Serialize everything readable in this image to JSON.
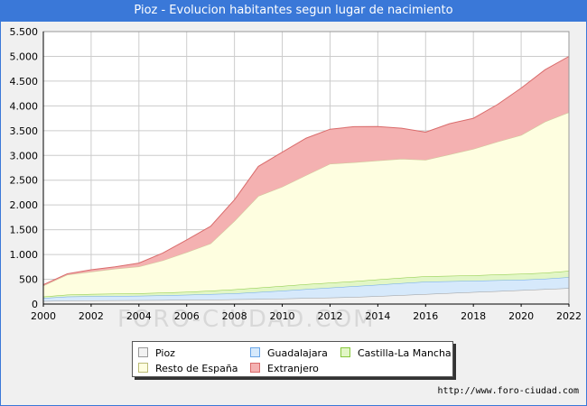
{
  "header": {
    "title": "Pioz - Evolucion habitantes segun lugar de nacimiento"
  },
  "footer": {
    "url": "http://www.foro-ciudad.com"
  },
  "watermark": "FORO-CIUDAD.COM",
  "chart_data": {
    "type": "area",
    "stacked": true,
    "x": [
      2000,
      2001,
      2002,
      2003,
      2004,
      2005,
      2006,
      2007,
      2008,
      2009,
      2010,
      2011,
      2012,
      2013,
      2014,
      2015,
      2016,
      2017,
      2018,
      2019,
      2020,
      2021,
      2022
    ],
    "xticks": [
      "2000",
      "2002",
      "2004",
      "2006",
      "2008",
      "2010",
      "2012",
      "2014",
      "2016",
      "2018",
      "2020",
      "2022"
    ],
    "xlim": [
      2000,
      2022
    ],
    "ylim": [
      0,
      5500
    ],
    "yticks": [
      0,
      500,
      1000,
      1500,
      2000,
      2500,
      3000,
      3500,
      4000,
      4500,
      5000,
      5500
    ],
    "ytick_labels": [
      "0",
      "500",
      "1.000",
      "1.500",
      "2.000",
      "2.500",
      "3.000",
      "3.500",
      "4.000",
      "4.500",
      "5.000",
      "5.500"
    ],
    "grid": true,
    "legend_position": "bottom",
    "series": [
      {
        "name": "Pioz",
        "color": "#f2f2f2",
        "line": "#999999",
        "values": [
          60,
          70,
          72,
          74,
          76,
          80,
          85,
          90,
          95,
          100,
          110,
          120,
          130,
          140,
          160,
          180,
          200,
          220,
          240,
          260,
          280,
          300,
          320
        ]
      },
      {
        "name": "Guadalajara",
        "color": "#d6e9fb",
        "line": "#6aa6e8",
        "values": [
          60,
          80,
          85,
          88,
          90,
          95,
          100,
          110,
          120,
          140,
          160,
          180,
          200,
          220,
          230,
          240,
          250,
          240,
          230,
          220,
          210,
          210,
          220
        ]
      },
      {
        "name": "Castilla-La Mancha",
        "color": "#e2f6c6",
        "line": "#86c83c",
        "values": [
          30,
          40,
          45,
          48,
          50,
          55,
          60,
          70,
          80,
          90,
          95,
          100,
          100,
          100,
          105,
          110,
          110,
          110,
          110,
          115,
          120,
          120,
          130
        ]
      },
      {
        "name": "Resto de España",
        "color": "#fefee0",
        "line": "#cccc99",
        "values": [
          220,
          400,
          450,
          500,
          540,
          650,
          800,
          950,
          1380,
          1850,
          2000,
          2200,
          2400,
          2400,
          2400,
          2400,
          2350,
          2450,
          2550,
          2680,
          2800,
          3050,
          3200
        ]
      },
      {
        "name": "Extranjero",
        "color": "#f4b1b1",
        "line": "#d96b6b",
        "values": [
          20,
          20,
          40,
          40,
          70,
          150,
          250,
          350,
          430,
          600,
          700,
          750,
          700,
          720,
          690,
          620,
          560,
          620,
          620,
          750,
          950,
          1050,
          1130
        ]
      }
    ]
  }
}
